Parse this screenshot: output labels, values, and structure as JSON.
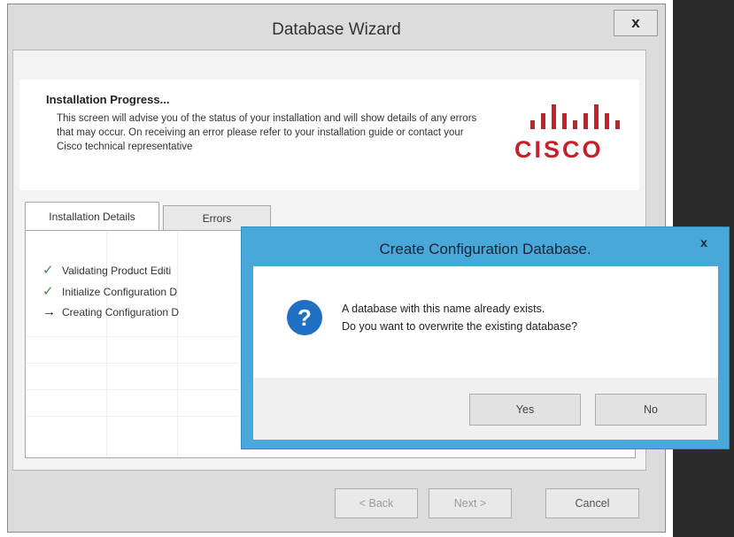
{
  "wizard": {
    "title": "Database Wizard",
    "close_label": "x",
    "header": {
      "title": "Installation Progress...",
      "description": "This screen will advise you of the status of your installation and will show details of any errors that may occur. On receiving an error please refer to your installation guide or contact your Cisco technical representative"
    },
    "logo": {
      "wordmark": "CISCO",
      "icon": "cisco-logo",
      "color": "#c6202a"
    },
    "tabs": [
      {
        "label": "Installation Details",
        "selected": true
      },
      {
        "label": "Errors",
        "selected": false
      }
    ],
    "steps": [
      {
        "icon": "check-icon",
        "text": "Validating Product Editi"
      },
      {
        "icon": "check-icon",
        "text": "Initialize Configuration D"
      },
      {
        "icon": "arrow-icon",
        "text": "Creating Configuration D"
      }
    ],
    "buttons": {
      "back": "< Back",
      "next": "Next >",
      "cancel": "Cancel"
    }
  },
  "dialog": {
    "title": "Create Configuration Database.",
    "close_label": "x",
    "icon": "question-icon",
    "message_line1": "A database with this name already exists.",
    "message_line2": "Do you want to overwrite the existing database?",
    "buttons": {
      "yes": "Yes",
      "no": "No"
    },
    "accent_color": "#47a8d9"
  }
}
